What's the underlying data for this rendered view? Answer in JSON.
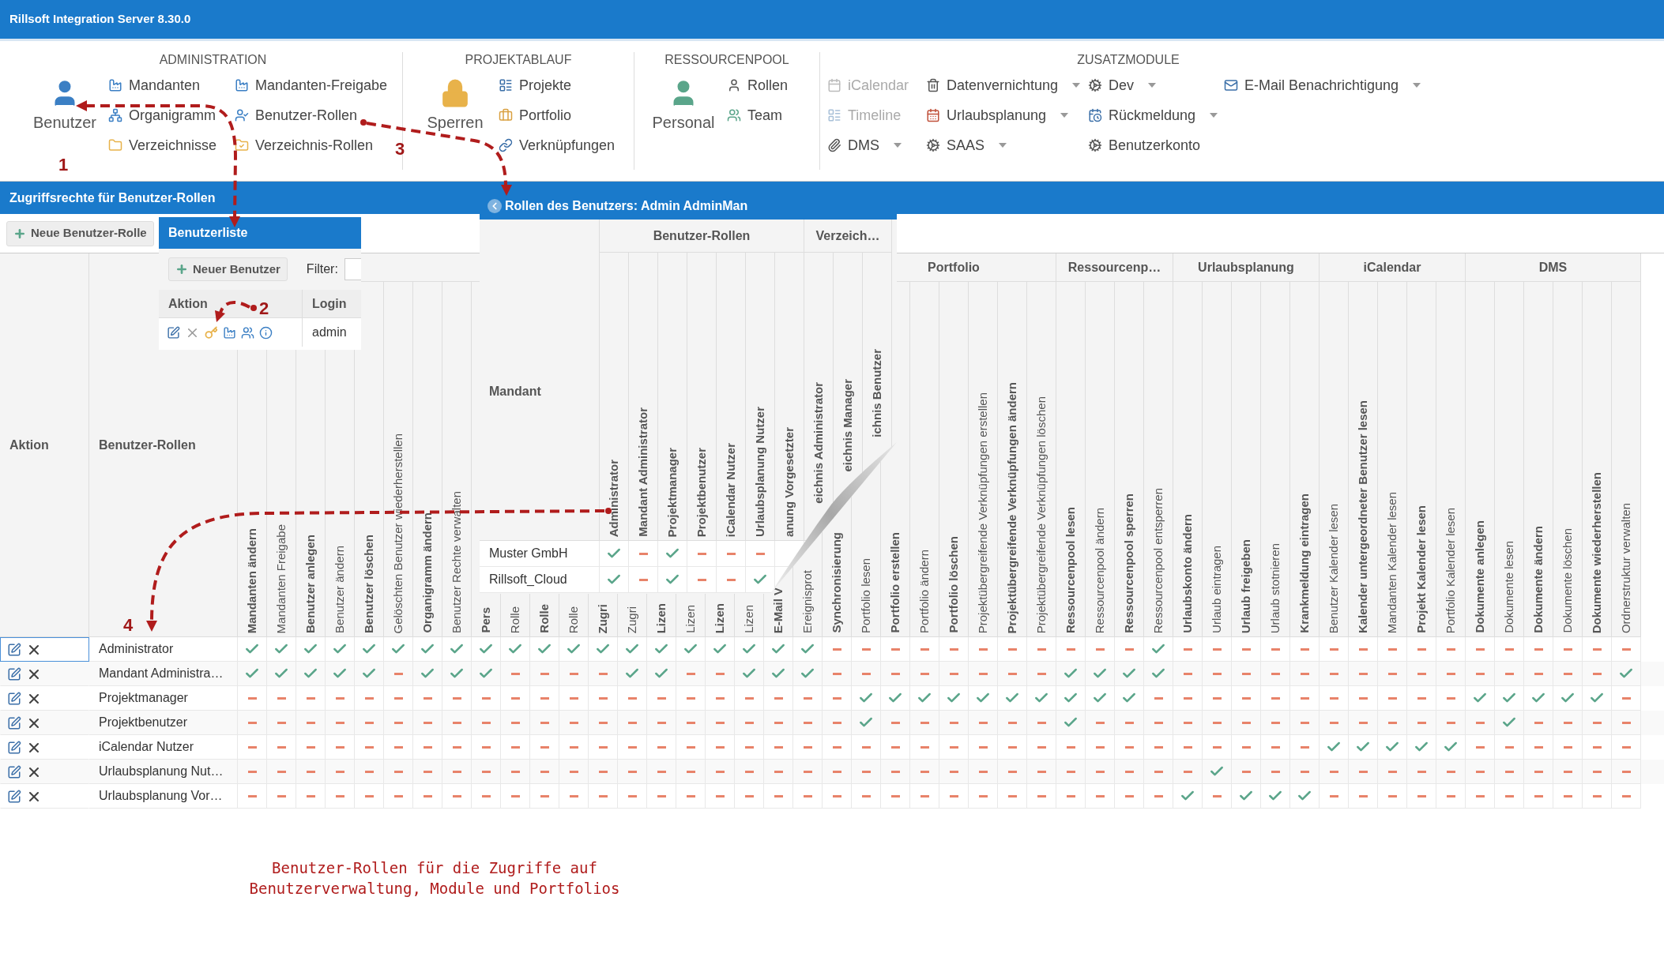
{
  "window": {
    "title": "Rillsoft Integration Server 8.30.0"
  },
  "ribbon": {
    "groups": [
      {
        "title": "ADMINISTRATION",
        "large": {
          "label": "Benutzer"
        },
        "columns": [
          [
            {
              "label": "Mandanten"
            },
            {
              "label": "Organigramm"
            },
            {
              "label": "Verzeichnisse"
            }
          ],
          [
            {
              "label": "Mandanten-Freigabe"
            },
            {
              "label": "Benutzer-Rollen"
            },
            {
              "label": "Verzeichnis-Rollen"
            }
          ]
        ]
      },
      {
        "title": "PROJEKTABLAUF",
        "large": {
          "label": "Sperren"
        },
        "columns": [
          [
            {
              "label": "Projekte"
            },
            {
              "label": "Portfolio"
            },
            {
              "label": "Verknüpfungen"
            }
          ]
        ]
      },
      {
        "title": "RESSOURCENPOOL",
        "large": {
          "label": "Personal"
        },
        "columns": [
          [
            {
              "label": "Rollen"
            },
            {
              "label": "Team"
            }
          ]
        ]
      },
      {
        "title": "ZUSATZMODULE",
        "columns": [
          [
            {
              "label": "iCalendar",
              "disabled": true,
              "dropdown": false
            },
            {
              "label": "Timeline",
              "disabled": true,
              "dropdown": false
            },
            {
              "label": "DMS",
              "disabled": false,
              "dropdown": true
            }
          ],
          [
            {
              "label": "Datenvernichtung",
              "disabled": false,
              "dropdown": true
            },
            {
              "label": "Urlaubsplanung",
              "disabled": false,
              "dropdown": true
            },
            {
              "label": "SAAS",
              "disabled": false,
              "dropdown": true
            }
          ],
          [
            {
              "label": "Dev",
              "disabled": false,
              "dropdown": true
            },
            {
              "label": "Rückmeldung",
              "disabled": false,
              "dropdown": true
            },
            {
              "label": "Benutzerkonto",
              "disabled": false,
              "dropdown": false
            }
          ],
          [
            {
              "label": "E-Mail Benachrichtigung",
              "disabled": false,
              "dropdown": true
            }
          ]
        ]
      }
    ]
  },
  "section": {
    "title": "Zugriffsrechte für Benutzer-Rollen",
    "new_button": "Neue Benutzer-Rolle"
  },
  "table": {
    "aktion_header": "Aktion",
    "role_header": "Benutzer-Rollen",
    "groups": [
      {
        "columns": [
          {
            "label": "Mandanten ändern",
            "bold": true
          },
          {
            "label": "Mandanten Freigabe",
            "bold": false
          },
          {
            "label": "Benutzer anlegen",
            "bold": true
          },
          {
            "label": "Benutzer ändern",
            "bold": false
          },
          {
            "label": "Benutzer löschen",
            "bold": true
          },
          {
            "label": "Gelöschten Benutzer wiederherstellen",
            "bold": false
          },
          {
            "label": "Organigramm ändern",
            "bold": true
          },
          {
            "label": "Benutzer Rechte verwalten",
            "bold": false
          },
          {
            "label": "Pers",
            "bold": true
          },
          {
            "label": "Rolle",
            "bold": false
          },
          {
            "label": "Rolle",
            "bold": true
          },
          {
            "label": "Rolle",
            "bold": false
          },
          {
            "label": "Zugri",
            "bold": true
          },
          {
            "label": "Zugri",
            "bold": false
          },
          {
            "label": "Lizen",
            "bold": true
          },
          {
            "label": "Lizen",
            "bold": false
          },
          {
            "label": "Lizen",
            "bold": true
          },
          {
            "label": "Lizen",
            "bold": false
          },
          {
            "label": "E-Mail V",
            "bold": true
          },
          {
            "label": "Ereignisprot",
            "bold": false
          },
          {
            "label": "Synchronisierung",
            "bold": true
          }
        ]
      },
      {
        "label": "Portfolio",
        "columns": [
          {
            "label": "Portfolio lesen",
            "bold": false
          },
          {
            "label": "Portfolio erstellen",
            "bold": true
          },
          {
            "label": "Portfolio ändern",
            "bold": false
          },
          {
            "label": "Portfolio löschen",
            "bold": true
          },
          {
            "label": "Projektübergreifende Verknüpfungen erstellen",
            "bold": false
          },
          {
            "label": "Projektübergreifende Verknüpfungen ändern",
            "bold": true
          },
          {
            "label": "Projektübergreifende Verknüpfungen löschen",
            "bold": false
          }
        ]
      },
      {
        "label": "Ressourcenp…",
        "columns": [
          {
            "label": "Ressourcenpool lesen",
            "bold": true
          },
          {
            "label": "Ressourcenpool ändern",
            "bold": false
          },
          {
            "label": "Ressourcenpool sperren",
            "bold": true
          },
          {
            "label": "Ressourcenpool entsperren",
            "bold": false
          }
        ]
      },
      {
        "label": "Urlaubsplanung",
        "columns": [
          {
            "label": "Urlaubskonto ändern",
            "bold": true
          },
          {
            "label": "Urlaub eintragen",
            "bold": false
          },
          {
            "label": "Urlaub freigeben",
            "bold": true
          },
          {
            "label": "Urlaub stotnieren",
            "bold": false
          },
          {
            "label": "Krankmeldung eintragen",
            "bold": true
          }
        ]
      },
      {
        "label": "iCalendar",
        "columns": [
          {
            "label": "Benutzer Kalender lesen",
            "bold": false
          },
          {
            "label": "Kalender untergeordneter Benutzer lesen",
            "bold": true
          },
          {
            "label": "Mandanten Kalender lesen",
            "bold": false
          },
          {
            "label": "Projekt Kalender lesen",
            "bold": true
          },
          {
            "label": "Portfolio Kalender lesen",
            "bold": false
          }
        ]
      },
      {
        "label": "DMS",
        "columns": [
          {
            "label": "Dokumente anlegen",
            "bold": true
          },
          {
            "label": "Dokumente lesen",
            "bold": false
          },
          {
            "label": "Dokumente ändern",
            "bold": true
          },
          {
            "label": "Dokumente löschen",
            "bold": false
          },
          {
            "label": "Dokumente wiederherstellen",
            "bold": true
          },
          {
            "label": "Ordnerstruktur verwalten",
            "bold": false
          }
        ]
      }
    ],
    "rows": [
      {
        "name": "Administrator",
        "focused": true,
        "rights": [
          true,
          true,
          true,
          true,
          true,
          true,
          true,
          true,
          true,
          true,
          true,
          true,
          true,
          true,
          true,
          true,
          true,
          true,
          true,
          true,
          false,
          false,
          false,
          false,
          false,
          false,
          false,
          false,
          false,
          false,
          false,
          true,
          false,
          false,
          false,
          false,
          false,
          false,
          false,
          false,
          false,
          false,
          false,
          false,
          false,
          false,
          false,
          false
        ]
      },
      {
        "name": "Mandant Administra…",
        "focused": false,
        "rights": [
          true,
          true,
          true,
          true,
          true,
          false,
          true,
          true,
          true,
          false,
          false,
          false,
          false,
          true,
          true,
          false,
          false,
          true,
          true,
          true,
          false,
          false,
          false,
          false,
          false,
          false,
          false,
          false,
          true,
          true,
          true,
          true,
          false,
          false,
          false,
          false,
          false,
          false,
          false,
          false,
          false,
          false,
          false,
          false,
          false,
          false,
          false,
          true
        ]
      },
      {
        "name": "Projektmanager",
        "focused": false,
        "rights": [
          false,
          false,
          false,
          false,
          false,
          false,
          false,
          false,
          false,
          false,
          false,
          false,
          false,
          false,
          false,
          false,
          false,
          false,
          false,
          false,
          false,
          true,
          true,
          true,
          true,
          true,
          true,
          true,
          true,
          true,
          true,
          false,
          false,
          false,
          false,
          false,
          false,
          false,
          false,
          false,
          false,
          false,
          true,
          true,
          true,
          true,
          true,
          false
        ]
      },
      {
        "name": "Projektbenutzer",
        "focused": false,
        "rights": [
          false,
          false,
          false,
          false,
          false,
          false,
          false,
          false,
          false,
          false,
          false,
          false,
          false,
          false,
          false,
          false,
          false,
          false,
          false,
          false,
          false,
          true,
          false,
          false,
          false,
          false,
          false,
          false,
          true,
          false,
          false,
          false,
          false,
          false,
          false,
          false,
          false,
          false,
          false,
          false,
          false,
          false,
          false,
          true,
          false,
          false,
          false,
          false
        ]
      },
      {
        "name": "iCalendar Nutzer",
        "focused": false,
        "rights": [
          false,
          false,
          false,
          false,
          false,
          false,
          false,
          false,
          false,
          false,
          false,
          false,
          false,
          false,
          false,
          false,
          false,
          false,
          false,
          false,
          false,
          false,
          false,
          false,
          false,
          false,
          false,
          false,
          false,
          false,
          false,
          false,
          false,
          false,
          false,
          false,
          false,
          true,
          true,
          true,
          true,
          true,
          false,
          false,
          false,
          false,
          false,
          false
        ]
      },
      {
        "name": "Urlaubsplanung Nut…",
        "focused": false,
        "rights": [
          false,
          false,
          false,
          false,
          false,
          false,
          false,
          false,
          false,
          false,
          false,
          false,
          false,
          false,
          false,
          false,
          false,
          false,
          false,
          false,
          false,
          false,
          false,
          false,
          false,
          false,
          false,
          false,
          false,
          false,
          false,
          false,
          false,
          true,
          false,
          false,
          false,
          false,
          false,
          false,
          false,
          false,
          false,
          false,
          false,
          false,
          false,
          false
        ]
      },
      {
        "name": "Urlaubsplanung Vor…",
        "focused": false,
        "rights": [
          false,
          false,
          false,
          false,
          false,
          false,
          false,
          false,
          false,
          false,
          false,
          false,
          false,
          false,
          false,
          false,
          false,
          false,
          false,
          false,
          false,
          false,
          false,
          false,
          false,
          false,
          false,
          false,
          false,
          false,
          false,
          false,
          true,
          false,
          true,
          true,
          true,
          false,
          false,
          false,
          false,
          false,
          false,
          false,
          false,
          false,
          false,
          false
        ]
      }
    ]
  },
  "user_list": {
    "title": "Benutzerliste",
    "new_button": "Neuer Benutzer",
    "filter_label": "Filter:",
    "columns": [
      "Aktion",
      "Login"
    ],
    "rows": [
      {
        "login": "admin"
      }
    ]
  },
  "user_roles": {
    "title": "Rollen des Benutzers: Admin AdminMan",
    "mandant_header": "Mandant",
    "groups": [
      {
        "label": "Benutzer-Rollen",
        "columns": [
          {
            "label": "Administrator"
          },
          {
            "label": "Mandant Administrator"
          },
          {
            "label": "Projektmanager"
          },
          {
            "label": "Projektbenutzer"
          },
          {
            "label": "iCalendar Nutzer"
          },
          {
            "label": "Urlaubsplanung Nutzer"
          },
          {
            "label": "anung Vorgesetzter"
          }
        ]
      },
      {
        "label": "Verzeich…",
        "columns": [
          {
            "label": "eichnis Administrator"
          },
          {
            "label": "eichnis Manager"
          },
          {
            "label": "ichnis Benutzer"
          }
        ]
      }
    ],
    "rows": [
      {
        "name": "Muster GmbH",
        "rights": [
          true,
          false,
          true,
          false,
          false,
          false
        ]
      },
      {
        "name": "Rillsoft_Cloud",
        "rights": [
          true,
          false,
          true,
          false,
          false,
          true
        ]
      }
    ]
  },
  "annotations": [
    {
      "label": "1"
    },
    {
      "label": "2"
    },
    {
      "label": "3"
    },
    {
      "label": "4"
    }
  ],
  "caption": [
    "Benutzer-Rollen für die Zugriffe auf",
    "Benutzerverwaltung, Module und Portfolios"
  ]
}
